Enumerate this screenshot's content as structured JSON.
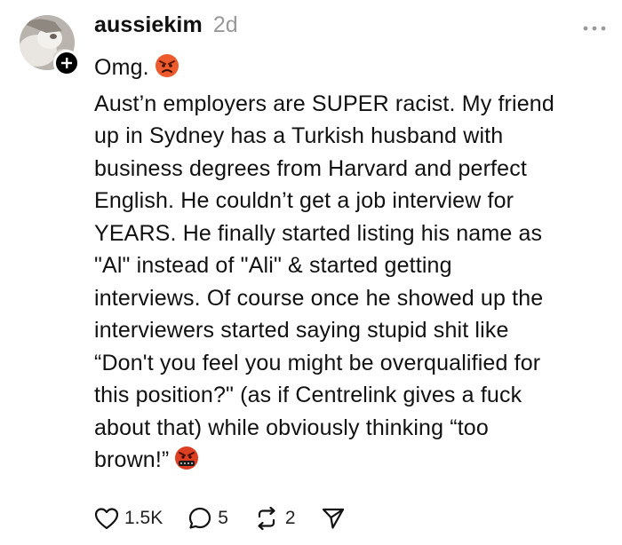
{
  "post": {
    "username": "aussiekim",
    "timestamp": "2d",
    "lines": [
      "Omg.",
      "Aust’n employers are SUPER racist. My friend",
      "up in Sydney has a Turkish husband with",
      "business degrees from Harvard and perfect",
      "English. He couldn’t get a job interview for",
      "YEARS. He finally started listing his name as",
      "\"Al\" instead of \"Ali\" & started getting",
      "interviews. Of course once he showed up the",
      "interviewers started saying stupid shit like",
      "“Don't you feel you might be overqualified for",
      "this position?\" (as if Centrelink gives a fuck",
      "about that) while obviously thinking “too",
      "brown!”"
    ],
    "emoji_first": "angry-face-icon",
    "emoji_last": "cursing-face-icon"
  },
  "actions": {
    "likes": "1.5K",
    "replies": "5",
    "reposts": "2"
  },
  "colors": {
    "text": "#111111",
    "muted": "#999999",
    "angry_emoji": "#e8542a",
    "cursing_emoji": "#d93a1f"
  }
}
